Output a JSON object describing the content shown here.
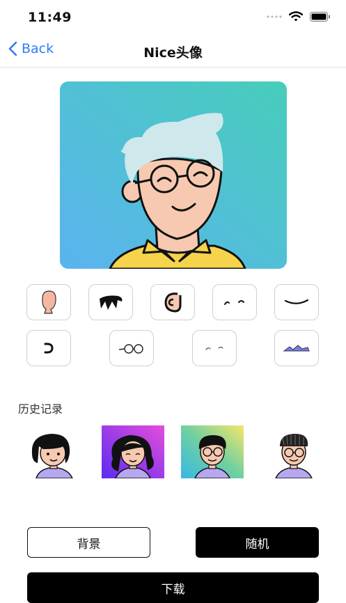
{
  "status_bar": {
    "time": "11:49",
    "icons": [
      "signal-dots-icon",
      "wifi-icon",
      "battery-icon"
    ]
  },
  "nav": {
    "back_label": "Back",
    "title": "Nice头像"
  },
  "colors": {
    "accent": "#2f7cf6",
    "preview_gradient_start": "#5bb3ef",
    "preview_gradient_end": "#47cdbb",
    "shirt": "#f5d34a",
    "hair": "#cfe8ec",
    "skin": "#f6c9b0"
  },
  "parts_row1": [
    "face-icon",
    "eyebrows-icon",
    "ear-icon",
    "eyes-icon",
    "mouth-icon"
  ],
  "parts_row2": [
    "nose-icon",
    "glasses-icon",
    "eye-detail-icon",
    "hat-icon"
  ],
  "history": {
    "label": "历史记录",
    "items": [
      "avatar-girl-white-bg",
      "avatar-girl-purple-bg",
      "avatar-boy-gradient-bg",
      "avatar-boy-beanie-white-bg"
    ]
  },
  "actions": {
    "background_label": "背景",
    "random_label": "随机",
    "download_label": "下载"
  }
}
